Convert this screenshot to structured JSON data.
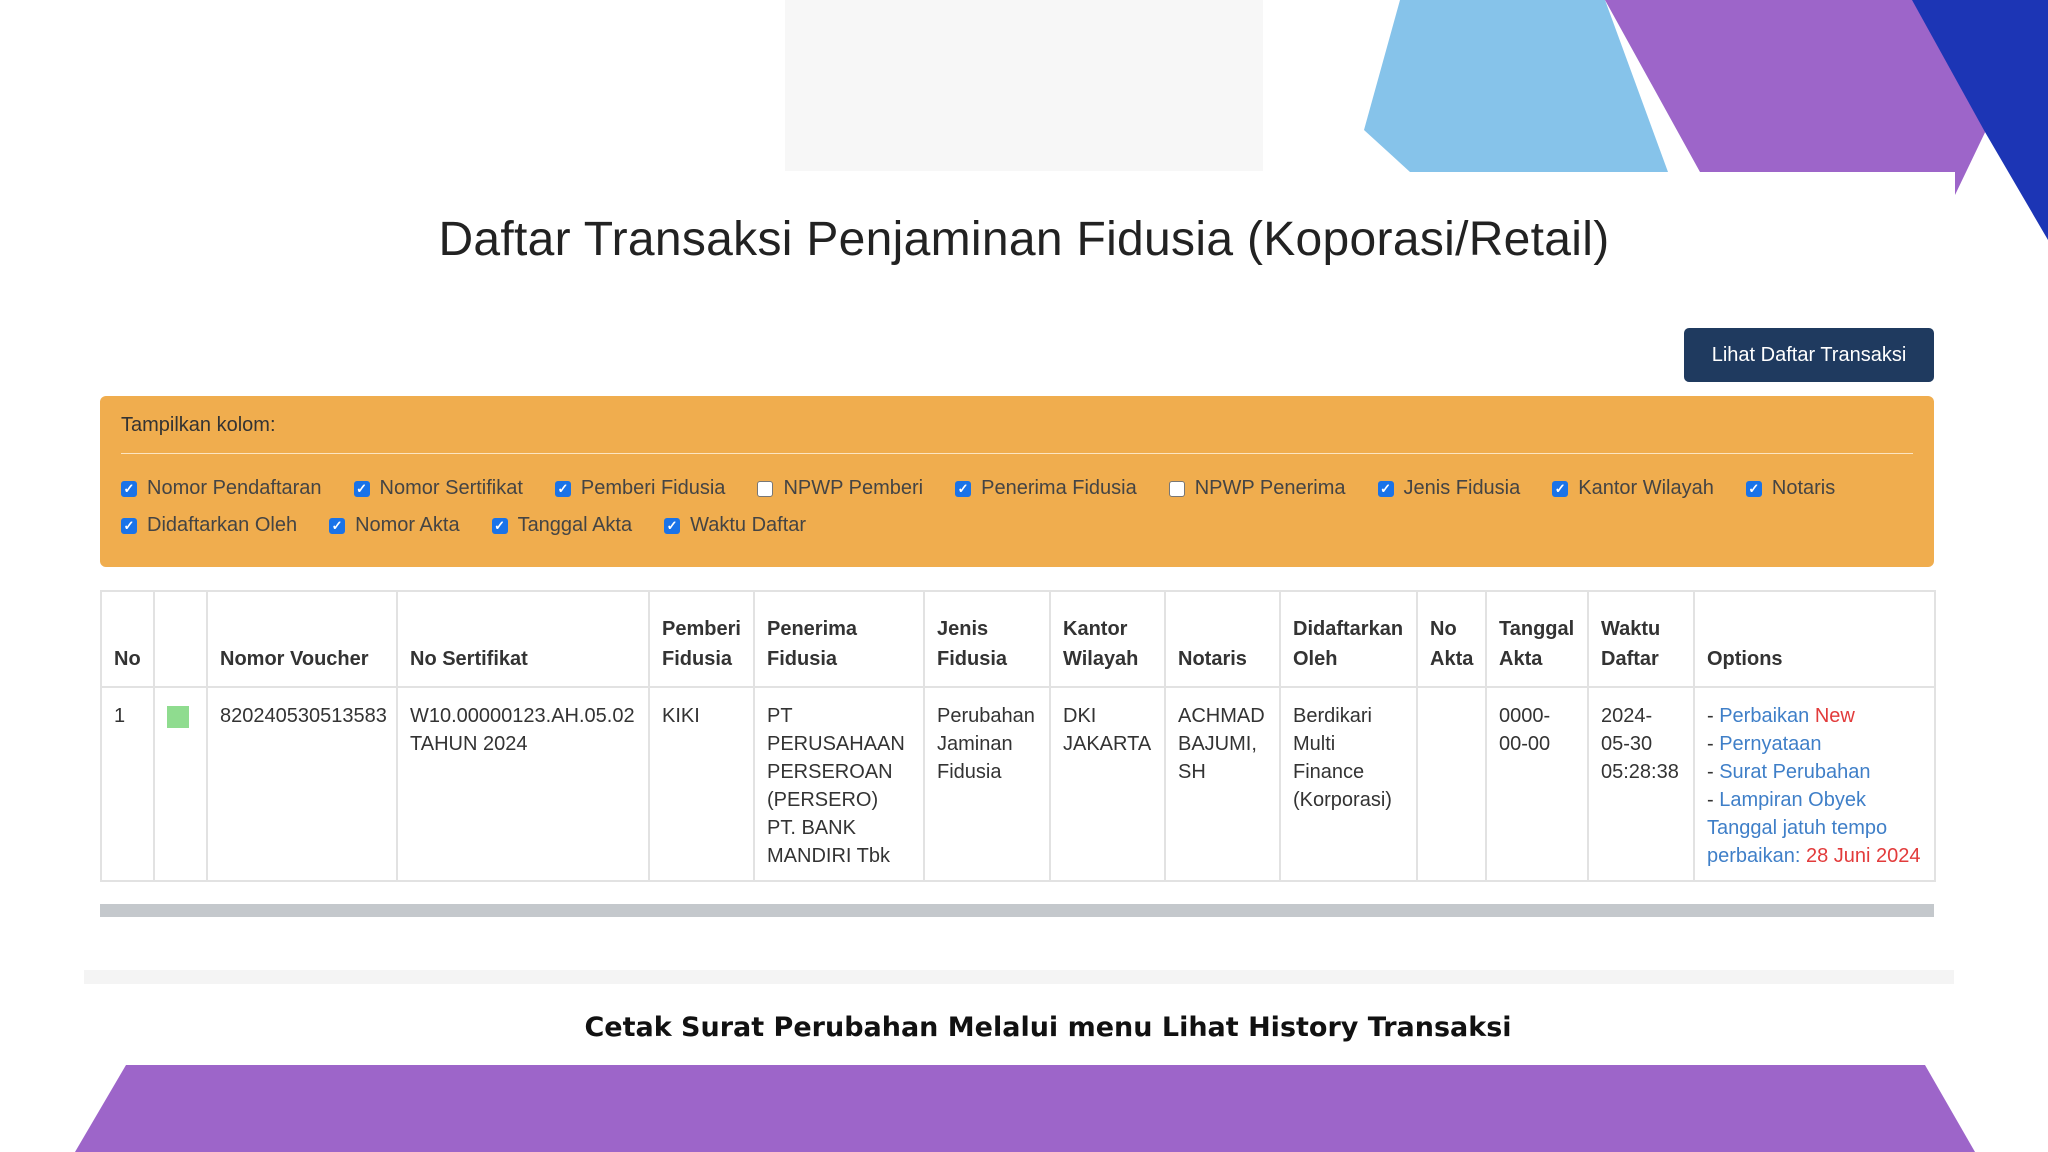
{
  "page": {
    "title": "Daftar Transaksi Penjaminan Fidusia (Koporasi/Retail)",
    "action_button": "Lihat Daftar Transaksi",
    "caption": "Cetak Surat Perubahan Melalui menu Lihat History Transaksi"
  },
  "column_panel": {
    "heading": "Tampilkan kolom:",
    "row1": [
      {
        "label": "Nomor Pendaftaran",
        "checked": true
      },
      {
        "label": "Nomor Sertifikat",
        "checked": true
      },
      {
        "label": "Pemberi Fidusia",
        "checked": true
      },
      {
        "label": "NPWP Pemberi",
        "checked": false
      },
      {
        "label": "Penerima Fidusia",
        "checked": true
      },
      {
        "label": "NPWP Penerima",
        "checked": false
      },
      {
        "label": "Jenis Fidusia",
        "checked": true
      },
      {
        "label": "Kantor Wilayah",
        "checked": true
      },
      {
        "label": "Notaris",
        "checked": true
      }
    ],
    "row2": [
      {
        "label": "Didaftarkan Oleh",
        "checked": true
      },
      {
        "label": "Nomor Akta",
        "checked": true
      },
      {
        "label": "Tanggal Akta",
        "checked": true
      },
      {
        "label": "Waktu Daftar",
        "checked": true
      }
    ]
  },
  "table": {
    "headers": {
      "no": "No",
      "status": "",
      "voucher": "Nomor Voucher",
      "sertifikat": "No Sertifikat",
      "pemberi_1": "Pemberi",
      "pemberi_2": "Fidusia",
      "penerima_1": "Penerima",
      "penerima_2": "Fidusia",
      "jenis_1": "Jenis",
      "jenis_2": "Fidusia",
      "kantor_1": "Kantor",
      "kantor_2": "Wilayah",
      "notaris": "Notaris",
      "didaftarkan_1": "Didaftarkan",
      "didaftarkan_2": "Oleh",
      "akta_1": "No",
      "akta_2": "Akta",
      "tanggal_1": "Tanggal",
      "tanggal_2": "Akta",
      "waktu_1": "Waktu",
      "waktu_2": "Daftar",
      "options": "Options"
    },
    "row": {
      "no": "1",
      "status_color": "#8fdc8f",
      "voucher": "820240530513583",
      "sertifikat_1": "W10.00000123.AH.05.02",
      "sertifikat_2": "TAHUN 2024",
      "pemberi": "KIKI",
      "penerima": [
        "PT",
        "PERUSAHAAN",
        "PERSEROAN",
        "(PERSERO)",
        "PT. BANK",
        "MANDIRI Tbk"
      ],
      "jenis": [
        "Perubahan",
        "Jaminan",
        "Fidusia"
      ],
      "kantor": [
        "DKI",
        "JAKARTA"
      ],
      "notaris": [
        "ACHMAD",
        "BAJUMI,",
        "SH"
      ],
      "didaftarkan": [
        "Berdikari",
        "Multi",
        "Finance",
        "(Korporasi)"
      ],
      "no_akta": "",
      "tanggal_akta": [
        "0000-",
        "00-00"
      ],
      "waktu_daftar": [
        "2024-",
        "05-30",
        "05:28:38"
      ],
      "options": {
        "dash": "- ",
        "perbaikan": "Perbaikan",
        "new_badge": "New",
        "pernyataan": "Pernyataan",
        "surat_perubahan": "Surat Perubahan",
        "lampiran": "Lampiran Obyek",
        "tempo_1": "Tanggal jatuh tempo",
        "tempo_2": "perbaikan:",
        "tempo_date": "28 Juni 2024"
      }
    }
  },
  "colors": {
    "panel": "#f0ad4e",
    "button": "#1f3a5f",
    "link": "#3f7fc8",
    "alert": "#e23b3b",
    "deco_blue": "#86c3ea",
    "deco_purple": "#9d65c9",
    "deco_navy": "#1c35b5"
  }
}
